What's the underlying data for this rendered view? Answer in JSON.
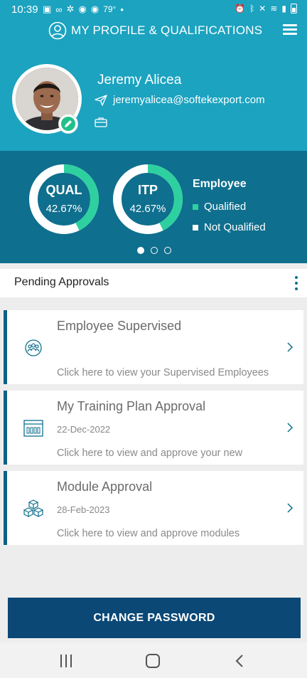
{
  "status_bar": {
    "time": "10:39",
    "temperature": "79°",
    "icons_left": [
      "teams-icon",
      "voicemail-icon",
      "pinwheel-icon",
      "chrome-icon",
      "chrome-icon"
    ],
    "icons_right": [
      "alarm-icon",
      "bluetooth-icon",
      "mute-icon",
      "wifi-icon",
      "signal-icon",
      "battery-icon"
    ]
  },
  "header": {
    "title": "MY PROFILE & QUALIFICATIONS"
  },
  "profile": {
    "name": "Jeremy Alicea",
    "email": "jeremyalicea@softekexport.com"
  },
  "stats": {
    "qual": {
      "label": "QUAL",
      "value_text": "42.67%",
      "value": 42.67
    },
    "itp": {
      "label": "ITP",
      "value_text": "42.67%",
      "value": 42.67
    },
    "legend_title": "Employee",
    "legend": [
      {
        "label": "Qualified",
        "color": "#2fd0a0"
      },
      {
        "label": "Not Qualified",
        "color": "#ffffff"
      }
    ],
    "pages": 3,
    "active_page": 1
  },
  "pending": {
    "title": "Pending Approvals",
    "cards": [
      {
        "title": "Employee Supervised",
        "date": "",
        "desc": "Click here to view your Supervised Employees",
        "icon": "group-icon"
      },
      {
        "title": "My Training Plan Approval",
        "date": "22-Dec-2022",
        "desc": "Click here to view and approve your new",
        "icon": "building-icon"
      },
      {
        "title": "Module Approval",
        "date": "28-Feb-2023",
        "desc": "Click here to view and approve modules",
        "icon": "cubes-icon"
      }
    ]
  },
  "actions": {
    "change_password": "CHANGE PASSWORD"
  },
  "colors": {
    "header_bg": "#1ba3c0",
    "stats_bg": "#0f6f8e",
    "qualified": "#2fd0a0",
    "button_bg": "#0b4876"
  }
}
